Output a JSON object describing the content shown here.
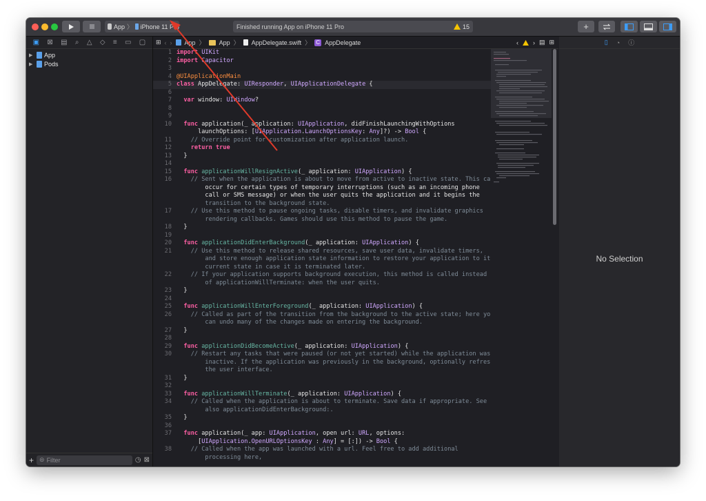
{
  "toolbar": {
    "scheme": "App",
    "device": "iPhone 11 Pro",
    "status_text": "Finished running App on iPhone 11 Pro",
    "warning_count": "15"
  },
  "navigator": {
    "items": [
      {
        "label": "App"
      },
      {
        "label": "Pods"
      }
    ],
    "filter_placeholder": "Filter"
  },
  "jumpbar": {
    "project": "App",
    "folder": "App",
    "file": "AppDelegate.swift",
    "symbol": "AppDelegate"
  },
  "inspector": {
    "empty_text": "No Selection"
  },
  "code": [
    {
      "n": "1",
      "t": "import UIKit"
    },
    {
      "n": "2",
      "t": "import Capacitor"
    },
    {
      "n": "3",
      "t": ""
    },
    {
      "n": "4",
      "t": "@UIApplicationMain"
    },
    {
      "n": "5",
      "t": "class AppDelegate: UIResponder, UIApplicationDelegate {"
    },
    {
      "n": "6",
      "t": ""
    },
    {
      "n": "7",
      "t": "  var window: UIWindow?"
    },
    {
      "n": "8",
      "t": ""
    },
    {
      "n": "9",
      "t": ""
    },
    {
      "n": "10",
      "t": "  func application(_ application: UIApplication, didFinishLaunchingWithOptions"
    },
    {
      "n": "",
      "t": "      launchOptions: [UIApplication.LaunchOptionsKey: Any]?) -> Bool {"
    },
    {
      "n": "11",
      "t": "    // Override point for customization after application launch."
    },
    {
      "n": "12",
      "t": "    return true"
    },
    {
      "n": "13",
      "t": "  }"
    },
    {
      "n": "14",
      "t": ""
    },
    {
      "n": "15",
      "t": "  func applicationWillResignActive(_ application: UIApplication) {"
    },
    {
      "n": "16",
      "t": "    // Sent when the application is about to move from active to inactive state. This can"
    },
    {
      "n": "",
      "t": "        occur for certain types of temporary interruptions (such as an incoming phone"
    },
    {
      "n": "",
      "t": "        call or SMS message) or when the user quits the application and it begins the"
    },
    {
      "n": "",
      "t": "        transition to the background state."
    },
    {
      "n": "17",
      "t": "    // Use this method to pause ongoing tasks, disable timers, and invalidate graphics"
    },
    {
      "n": "",
      "t": "        rendering callbacks. Games should use this method to pause the game."
    },
    {
      "n": "18",
      "t": "  }"
    },
    {
      "n": "19",
      "t": ""
    },
    {
      "n": "20",
      "t": "  func applicationDidEnterBackground(_ application: UIApplication) {"
    },
    {
      "n": "21",
      "t": "    // Use this method to release shared resources, save user data, invalidate timers,"
    },
    {
      "n": "",
      "t": "        and store enough application state information to restore your application to its"
    },
    {
      "n": "",
      "t": "        current state in case it is terminated later."
    },
    {
      "n": "22",
      "t": "    // If your application supports background execution, this method is called instead"
    },
    {
      "n": "",
      "t": "        of applicationWillTerminate: when the user quits."
    },
    {
      "n": "23",
      "t": "  }"
    },
    {
      "n": "24",
      "t": ""
    },
    {
      "n": "25",
      "t": "  func applicationWillEnterForeground(_ application: UIApplication) {"
    },
    {
      "n": "26",
      "t": "    // Called as part of the transition from the background to the active state; here you"
    },
    {
      "n": "",
      "t": "        can undo many of the changes made on entering the background."
    },
    {
      "n": "27",
      "t": "  }"
    },
    {
      "n": "28",
      "t": ""
    },
    {
      "n": "29",
      "t": "  func applicationDidBecomeActive(_ application: UIApplication) {"
    },
    {
      "n": "30",
      "t": "    // Restart any tasks that were paused (or not yet started) while the application was"
    },
    {
      "n": "",
      "t": "        inactive. If the application was previously in the background, optionally refresh"
    },
    {
      "n": "",
      "t": "        the user interface."
    },
    {
      "n": "31",
      "t": "  }"
    },
    {
      "n": "32",
      "t": ""
    },
    {
      "n": "33",
      "t": "  func applicationWillTerminate(_ application: UIApplication) {"
    },
    {
      "n": "34",
      "t": "    // Called when the application is about to terminate. Save data if appropriate. See"
    },
    {
      "n": "",
      "t": "        also applicationDidEnterBackground:."
    },
    {
      "n": "35",
      "t": "  }"
    },
    {
      "n": "36",
      "t": ""
    },
    {
      "n": "37",
      "t": "  func application(_ app: UIApplication, open url: URL, options:"
    },
    {
      "n": "",
      "t": "      [UIApplication.OpenURLOptionsKey : Any] = [:]) -> Bool {"
    },
    {
      "n": "38",
      "t": "    // Called when the app was launched with a url. Feel free to add additional"
    },
    {
      "n": "",
      "t": "        processing here,"
    }
  ]
}
